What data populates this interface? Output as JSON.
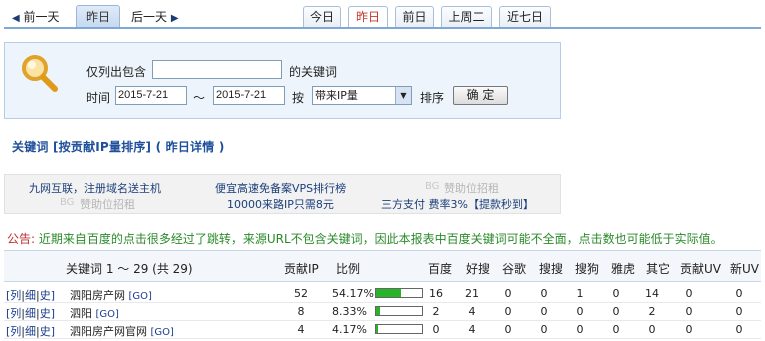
{
  "nav": {
    "prev_label": "前一天",
    "current_label": "昨日",
    "next_label": "后一天",
    "tabs": [
      "今日",
      "昨日",
      "前日",
      "上周二",
      "近七日"
    ],
    "active_tab": "昨日"
  },
  "search": {
    "only_contains_label": "仅列出包含",
    "keyword_suffix": "的关键词",
    "keyword_value": "",
    "time_label": "时间",
    "date_from": "2015-7-21",
    "range_sep": "～",
    "date_to": "2015-7-21",
    "by_label": "按",
    "sort_value": "带来IP量",
    "sort_label": "排序",
    "confirm_label": "确 定"
  },
  "heading": "关键词 [按贡献IP量排序] ( 昨日详情 )",
  "ads": {
    "a1": "九网互联，注册域名送主机",
    "a2": "便宜高速免备案VPS排行榜",
    "a3": "赞助位招租",
    "a4": "赞助位招租",
    "a5": "10000来路IP只需8元",
    "a6": "三方支付 费率3%【提款秒到】",
    "badge": "BG"
  },
  "notice": {
    "head": "公告:",
    "text": "近期来自百度的点击很多经过了跳转，来源URL不包含关键词，因此本报表中百度关键词可能不全面，点击数也可能低于实际值。"
  },
  "table": {
    "headers": {
      "keyword": "关键词 1 ～ 29 (共 29)",
      "ip": "贡献IP",
      "ratio": "比例",
      "baidu": "百度",
      "haosou": "好搜",
      "google": "谷歌",
      "soso": "搜搜",
      "sogou": "搜狗",
      "yahoo": "雅虎",
      "other": "其它",
      "uv": "贡献UV",
      "newuv": "新UV"
    },
    "ops": {
      "list": "[列",
      "detail": "细",
      "history": "史]",
      "go": "[GO]"
    },
    "rows": [
      {
        "keyword": "泗阳房产网",
        "ip": "52",
        "ratio": "54.17%",
        "ratio_value": 54.17,
        "baidu": "16",
        "haosou": "21",
        "google": "0",
        "soso": "0",
        "sogou": "1",
        "yahoo": "0",
        "other": "14",
        "uv": "0",
        "newuv": "0"
      },
      {
        "keyword": "泗阳",
        "ip": "8",
        "ratio": "8.33%",
        "ratio_value": 8.33,
        "baidu": "2",
        "haosou": "4",
        "google": "0",
        "soso": "0",
        "sogou": "0",
        "yahoo": "0",
        "other": "2",
        "uv": "0",
        "newuv": "0"
      },
      {
        "keyword": "泗阳房产网官网",
        "ip": "4",
        "ratio": "4.17%",
        "ratio_value": 4.17,
        "baidu": "0",
        "haosou": "4",
        "google": "0",
        "soso": "0",
        "sogou": "0",
        "yahoo": "0",
        "other": "0",
        "uv": "0",
        "newuv": "0"
      }
    ]
  },
  "colors": {
    "accent": "#1f4f9a",
    "bar_fill": "#28b428",
    "notice": "#2a8a2a",
    "active_tab": "#c0392b"
  }
}
